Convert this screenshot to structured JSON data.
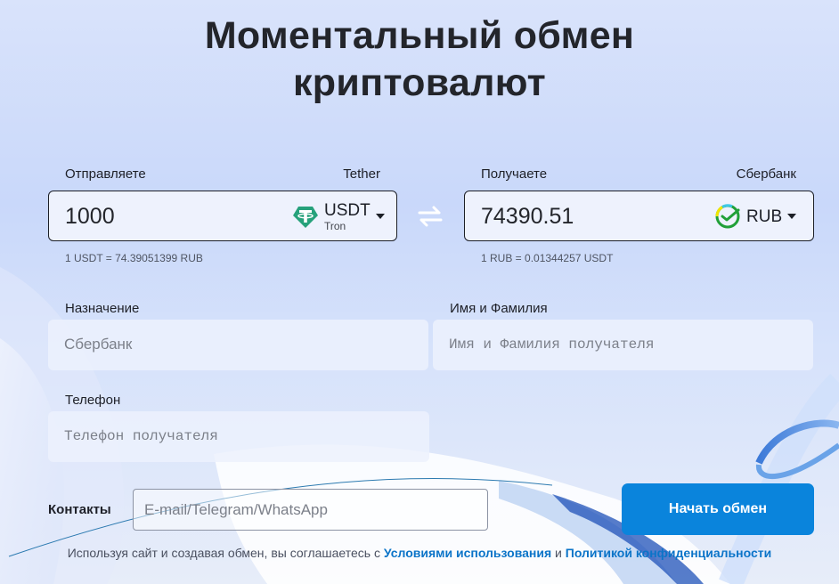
{
  "title": {
    "line1": "Моментальный обмен",
    "line2": "криптовалют"
  },
  "send": {
    "label": "Отправляете",
    "provider": "Tether",
    "amount": "1000",
    "currency": "USDT",
    "network": "Tron",
    "icon": "tether-icon",
    "rate": "1 USDT = 74.39051399 RUB"
  },
  "receive": {
    "label": "Получаете",
    "provider": "Сбербанк",
    "amount": "74390.51",
    "currency": "RUB",
    "icon": "sberbank-icon",
    "rate": "1 RUB = 0.01344257 USDT"
  },
  "form": {
    "purpose_label": "Назначение",
    "purpose_placeholder": "Сбербанк",
    "name_label": "Имя и Фамилия",
    "name_placeholder": "Имя и Фамилия получателя",
    "phone_label": "Телефон",
    "phone_placeholder": "Телефон получателя",
    "contacts_label": "Контакты",
    "contacts_placeholder": "E-mail/Telegram/WhatsApp",
    "submit_label": "Начать обмен"
  },
  "footer": {
    "text": "Используя сайт и создавая обмен, вы соглашаетесь с",
    "terms_link": "Условиями использования",
    "and": "и",
    "privacy_link": "Политикой конфиденциальности"
  },
  "colors": {
    "accent": "#0a84dc",
    "tether": "#26a17b",
    "sber": "#21a038"
  }
}
